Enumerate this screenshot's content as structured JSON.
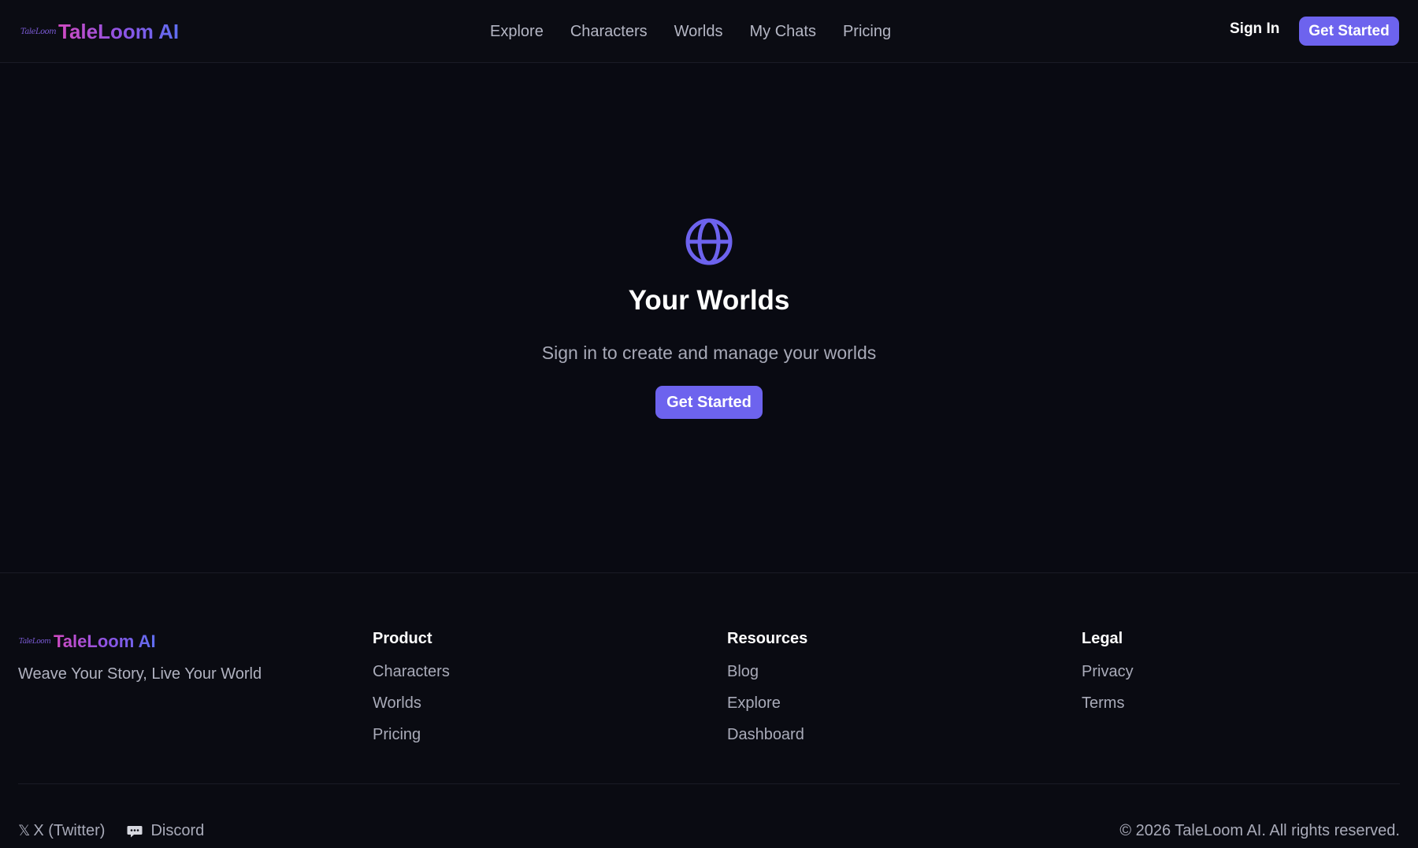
{
  "header": {
    "logo_text": "TaleLoom",
    "brand": "TaleLoom AI",
    "nav": [
      "Explore",
      "Characters",
      "Worlds",
      "My Chats",
      "Pricing"
    ],
    "sign_in": "Sign In",
    "get_started": "Get Started"
  },
  "hero": {
    "icon": "globe-icon",
    "title": "Your Worlds",
    "subtitle": "Sign in to create and manage your worlds",
    "cta": "Get Started"
  },
  "footer": {
    "logo_text": "TaleLoom",
    "brand": "TaleLoom AI",
    "tagline": "Weave Your Story, Live Your World",
    "columns": [
      {
        "title": "Product",
        "links": [
          "Characters",
          "Worlds",
          "Pricing"
        ]
      },
      {
        "title": "Resources",
        "links": [
          "Blog",
          "Explore",
          "Dashboard"
        ]
      },
      {
        "title": "Legal",
        "links": [
          "Privacy",
          "Terms"
        ]
      }
    ],
    "socials": [
      {
        "icon": "x-icon",
        "glyph": "𝕏",
        "label": "X (Twitter)"
      },
      {
        "icon": "discord-icon",
        "label": "Discord"
      }
    ],
    "copyright": "© 2026 TaleLoom AI. All rights reserved."
  },
  "colors": {
    "background": "#090a12",
    "accent": "#6d63ee",
    "brand_gradient_start": "#d24bc2",
    "brand_gradient_end": "#5f6ef0"
  }
}
